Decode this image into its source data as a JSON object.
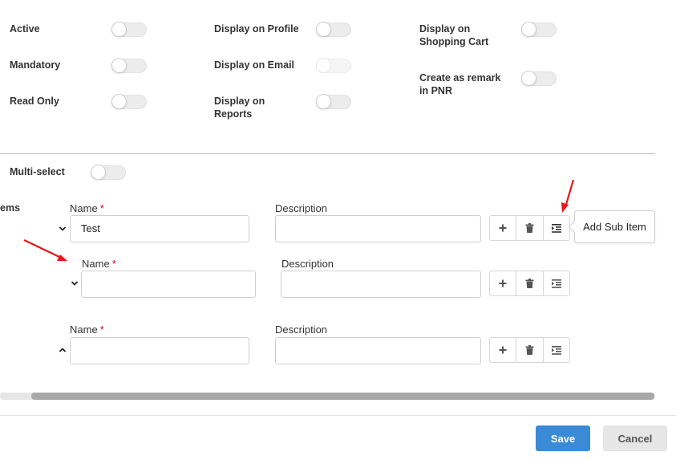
{
  "settings": {
    "active": "Active",
    "mandatory": "Mandatory",
    "read_only": "Read Only",
    "display_on_profile": "Display on Profile",
    "display_on_email": "Display on Email",
    "display_on_reports_line1": "Display on",
    "display_on_reports_line2": "Reports",
    "display_on_cart_line1": "Display on",
    "display_on_cart_line2": "Shopping Cart",
    "create_remark_line1": "Create as remark",
    "create_remark_line2": "in PNR",
    "multi_select": "Multi-select"
  },
  "items": {
    "section_label": "ems",
    "name_label": "Name",
    "required_mark": "*",
    "description_label": "Description",
    "rows": [
      {
        "name_value": "Test",
        "description_value": "",
        "chevron": "chevron-down-icon"
      },
      {
        "name_value": "",
        "description_value": "",
        "chevron": "chevron-down-icon"
      },
      {
        "name_value": "",
        "description_value": "",
        "chevron": "chevron-up-icon"
      }
    ],
    "actions": [
      "plus-icon",
      "trash-icon",
      "indent-icon"
    ]
  },
  "tooltip": {
    "text": "Add Sub Item"
  },
  "footer": {
    "save_label": "Save",
    "cancel_label": "Cancel"
  },
  "colors": {
    "primary": "#3a8ad6",
    "required": "#d0021b",
    "annotation_arrow": "#e8161b"
  }
}
